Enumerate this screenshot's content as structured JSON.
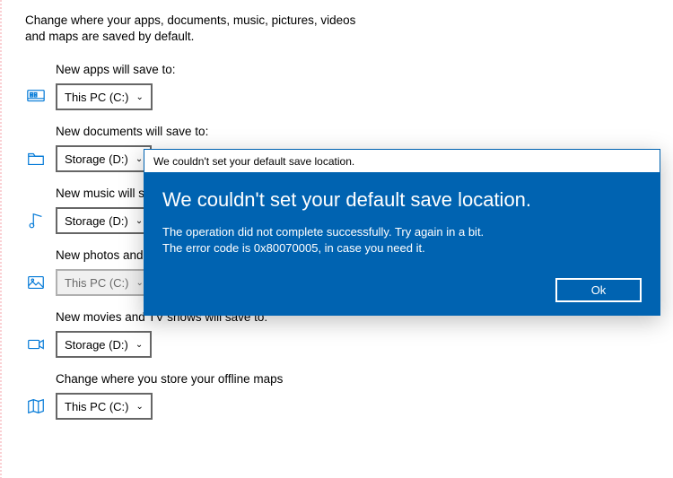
{
  "intro": "Change where your apps, documents, music, pictures, videos and maps are saved by default.",
  "settings": {
    "apps": {
      "label": "New apps will save to:",
      "value": "This PC (C:)"
    },
    "docs": {
      "label": "New documents will save to:",
      "value": "Storage (D:)"
    },
    "music": {
      "label": "New music will sav",
      "value": "Storage (D:)"
    },
    "photos": {
      "label": "New photos and v",
      "value": "This PC (C:)"
    },
    "movies": {
      "label": "New movies and TV shows will save to:",
      "value": "Storage (D:)"
    },
    "maps": {
      "label": "Change where you store your offline maps",
      "value": "This PC (C:)"
    }
  },
  "dialog": {
    "title": "We couldn't set your default save location.",
    "heading": "We couldn't set your default save location.",
    "line1": "The operation did not complete successfully. Try again in a bit.",
    "line2": "The error code is 0x80070005, in case you need it.",
    "ok": "Ok"
  }
}
